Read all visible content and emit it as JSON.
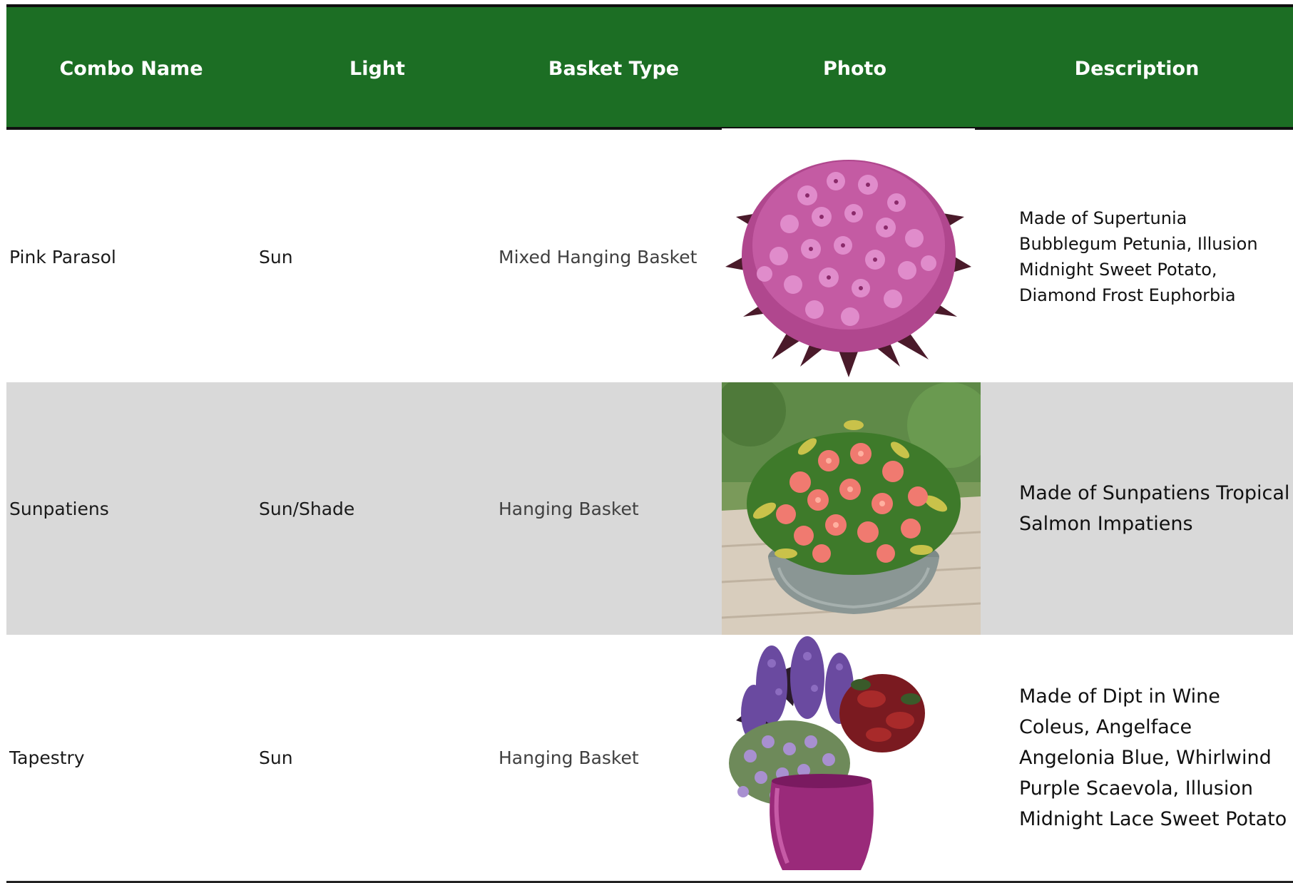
{
  "headers": {
    "combo_name": "Combo Name",
    "light": "Light",
    "basket_type": "Basket Type",
    "photo": "Photo",
    "description": "Description"
  },
  "rows": [
    {
      "combo_name": "Pink Parasol",
      "light": "Sun",
      "basket_type": "Mixed Hanging Basket",
      "photo_icon": "pink-petunia-basket-photo",
      "description": "Made of Supertunia Bubblegum Petunia, Illusion Midnight Sweet Potato, Diamond Frost Euphorbia"
    },
    {
      "combo_name": "Sunpatiens",
      "light": "Sun/Shade",
      "basket_type": "Hanging Basket",
      "photo_icon": "salmon-impatiens-pot-photo",
      "description": "Made of Sunpatiens Tropical Salmon Impatiens"
    },
    {
      "combo_name": "Tapestry",
      "light": "Sun",
      "basket_type": "Hanging Basket",
      "photo_icon": "purple-mixed-planter-photo",
      "description": "Made of Dipt in Wine Coleus, Angelface Angelonia Blue, Whirlwind Purple Scaevola, Illusion Midnight Lace Sweet Potato"
    }
  ],
  "colors": {
    "header_bg": "#1c6e24",
    "header_text": "#ffffff",
    "shaded_row": "#d9d9d9"
  }
}
